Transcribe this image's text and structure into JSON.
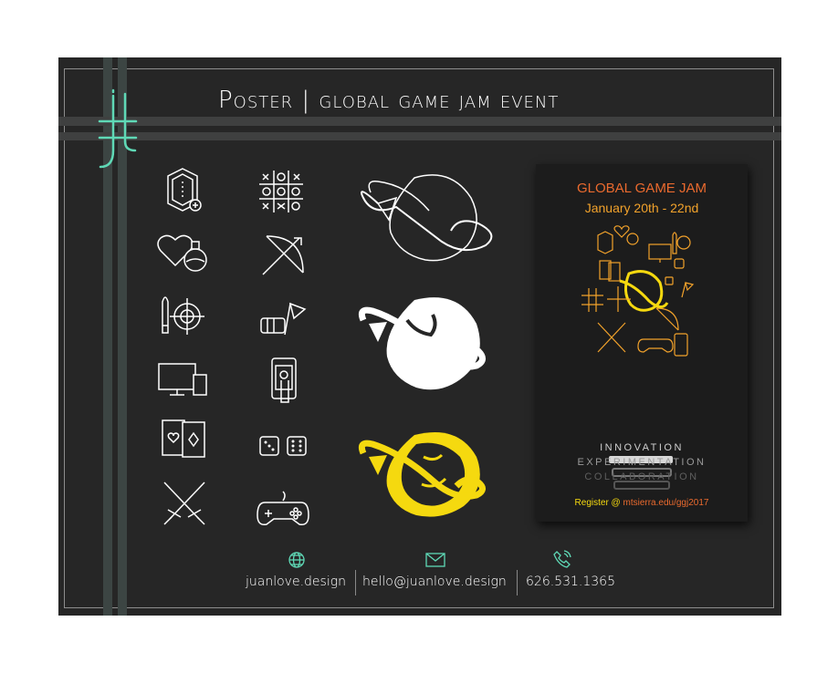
{
  "title": "Poster | global game jam event",
  "logo": {
    "monogram": "jl"
  },
  "poster": {
    "title": "GLOBAL GAME JAM",
    "dates": "January 20th - 22nd",
    "words": [
      "INNOVATION",
      "EXPERIMENTATION",
      "COLLABORATION"
    ],
    "register_prefix": "Register @ ",
    "register_url": "mtsierra.edu/ggj2017"
  },
  "icons": {
    "left_column": [
      "gem-icon",
      "heart-potion-icon",
      "bullet-target-icon",
      "monitor-tablet-icon",
      "playing-cards-icon",
      "crossed-swords-icon"
    ],
    "middle_column": [
      "tic-tac-toe-icon",
      "bow-arrow-icon",
      "fist-flag-icon",
      "phone-hand-icon",
      "dice-icon",
      "gamepad-icon"
    ],
    "logo_variants": [
      "outline",
      "white-fill",
      "yellow-fill"
    ]
  },
  "contact": {
    "website": "juanlove.design",
    "email": "hello@juanlove.design",
    "phone": "626.531.1365"
  },
  "colors": {
    "background": "#262626",
    "accent_teal": "#5fd9b6",
    "logo_yellow": "#f5d90f",
    "poster_orange": "#ea6a2e",
    "poster_gold": "#f2a22b"
  }
}
